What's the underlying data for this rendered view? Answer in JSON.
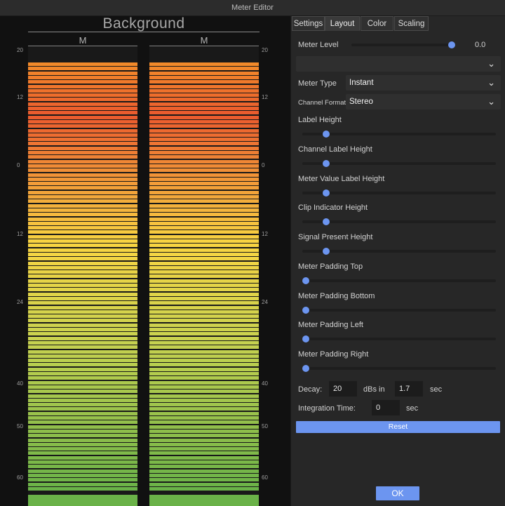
{
  "window": {
    "title": "Meter Editor"
  },
  "meter": {
    "title": "Background",
    "channels": [
      "M",
      "M"
    ],
    "scale_labels": [
      "20",
      "12",
      "0",
      "12",
      "24",
      "40",
      "50",
      "60"
    ],
    "colors": {
      "top": "#f28a2a",
      "upper": "#ea5a2e",
      "middle": "#f8d442",
      "lower": "#c8d250",
      "bottom": "#6ab248"
    }
  },
  "tabs": [
    {
      "label": "Settings",
      "active": false
    },
    {
      "label": "Layout",
      "active": true
    },
    {
      "label": "Color",
      "active": false
    },
    {
      "label": "Scaling",
      "active": false
    }
  ],
  "meter_level": {
    "label": "Meter Level",
    "value": "0.0",
    "fraction": 1.0
  },
  "empty_select": {
    "value": ""
  },
  "meter_type": {
    "label": "Meter Type",
    "value": "Instant"
  },
  "channel_format": {
    "label": "Channel Format",
    "value": "Stereo"
  },
  "sliders": [
    {
      "label": "Label Height",
      "fraction": 0.11
    },
    {
      "label": "Channel Label Height",
      "fraction": 0.11
    },
    {
      "label": "Meter Value Label Height",
      "fraction": 0.11
    },
    {
      "label": "Clip Indicator Height",
      "fraction": 0.11
    },
    {
      "label": "Signal Present Height",
      "fraction": 0.11
    },
    {
      "label": "Meter Padding Top",
      "fraction": 0.0
    },
    {
      "label": "Meter Padding Bottom",
      "fraction": 0.0
    },
    {
      "label": "Meter Padding Left",
      "fraction": 0.0
    },
    {
      "label": "Meter Padding Right",
      "fraction": 0.0
    }
  ],
  "decay": {
    "label": "Decay:",
    "value": "20",
    "mid_label": "dBs in",
    "time": "1.7",
    "unit": "sec"
  },
  "integration": {
    "label": "Integration Time:",
    "value": "0",
    "unit": "sec"
  },
  "buttons": {
    "reset": "Reset",
    "ok": "OK"
  },
  "accent_color": "#6c95f0"
}
